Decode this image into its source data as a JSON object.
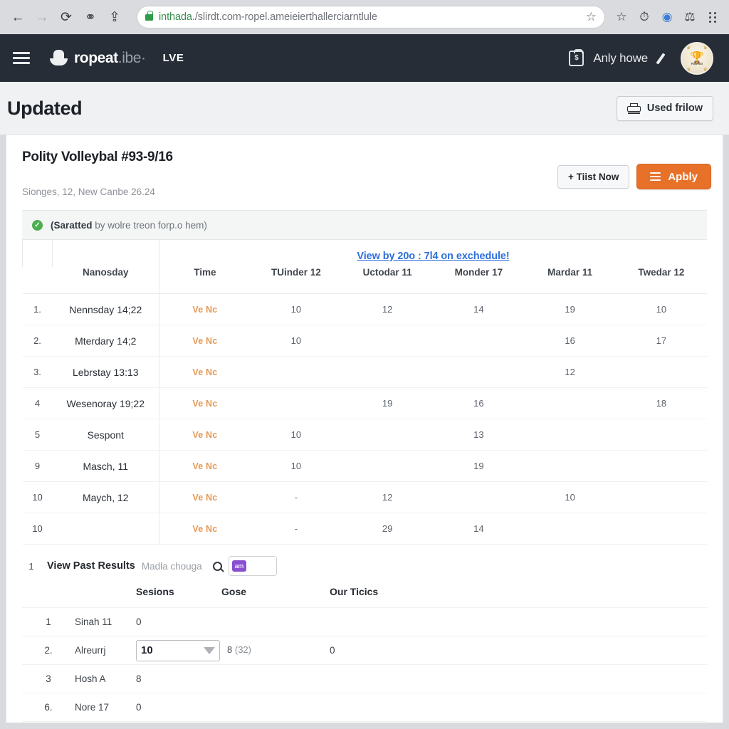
{
  "browser": {
    "back_icon": "back-arrow-icon",
    "forward_icon": "forward-arrow-icon",
    "reload_icon": "reload-icon",
    "pin_icon": "pin-icon",
    "share_icon": "share-icon",
    "url_host": "inthada.",
    "url_path": "/slirdt.com-ropel.ameieierthallerciarntlule",
    "bookmark_star": "☆",
    "toolbar_icons": [
      "star-icon",
      "history-clock-icon",
      "profile-icon",
      "extension-icon",
      "menu-dots-icon"
    ]
  },
  "appbar": {
    "menu_label": "hamburger-menu",
    "brand_primary": "ropeat",
    "brand_secondary": ".ibe·",
    "live_label": "LVE",
    "account_name": "Anly howe",
    "bag_symbol": "$",
    "avatar_crest": "🏆",
    "avatar_label": "Ropeat!",
    "avatar_bits_top": [
      "♟",
      "♟"
    ],
    "avatar_bits_bottom": [
      "♟",
      "♟"
    ]
  },
  "page_header": {
    "title": "Updated",
    "print_button": "Used frilow"
  },
  "card": {
    "title": "Polity Volleybal #93-9/16",
    "subtitle": "Sionges, 12, New Canbe 26.24",
    "btn_secondary": "+ Tiist Now",
    "btn_primary": "Apbly",
    "alert_bold": "(Saratted",
    "alert_rest": "by wolre treon forp.o hem)",
    "accent_color": "#e8712a",
    "link_color": "#2f6fdb"
  },
  "main_table": {
    "span_link": "View by 20o : 7l4 on exchedule!",
    "headers": [
      "",
      "Nanosday",
      "Time",
      "TUinder 12",
      "Uctodar 11",
      "Monder 17",
      "Mardar 11",
      "Twedar 12"
    ],
    "venue_link_label": "Ve Nc",
    "rows": [
      {
        "idx": "1.",
        "day": "Nennsday 14;22",
        "time": "Ve Nc",
        "c1": "10",
        "c2": "12",
        "c3": "14",
        "c4": "19",
        "c5": "10"
      },
      {
        "idx": "2.",
        "day": "Mterdary 14;2",
        "time": "Ve Nc",
        "c1": "10",
        "c2": "",
        "c3": "",
        "c4": "16",
        "c5": "17"
      },
      {
        "idx": "3.",
        "day": "Lebrstay 13:13",
        "time": "Ve Nc",
        "c1": "",
        "c2": "",
        "c3": "",
        "c4": "12",
        "c5": ""
      },
      {
        "idx": "4",
        "day": "Wesenoray 19;22",
        "time": "Ve Nc",
        "c1": "",
        "c2": "19",
        "c3": "16",
        "c4": "",
        "c5": "18"
      },
      {
        "idx": "5",
        "day": "Sespont",
        "time": "Ve Nc",
        "c1": "10",
        "c2": "",
        "c3": "13",
        "c4": "",
        "c5": ""
      },
      {
        "idx": "9",
        "day": "Masch, 11",
        "time": "Ve Nc",
        "c1": "10",
        "c2": "",
        "c3": "19",
        "c4": "",
        "c5": ""
      },
      {
        "idx": "10",
        "day": "Maych, 12",
        "time": "Ve Nc",
        "c1": "-",
        "c2": "12",
        "c3": "",
        "c4": "10",
        "c5": ""
      },
      {
        "idx": "10",
        "day": "",
        "time": "Ve Nc",
        "c1": "-",
        "c2": "29",
        "c3": "14",
        "c4": "",
        "c5": ""
      }
    ]
  },
  "past_results": {
    "row_index": "1",
    "title": "View Past Results",
    "note": "Madla chouga",
    "search_placeholder": "",
    "search_chip": "am",
    "headers": [
      "",
      "",
      "Sesions",
      "Gose",
      "Our Ticics"
    ],
    "rows": [
      {
        "idx": "1",
        "name": "Sinah 11",
        "sessions": "0",
        "gose": "",
        "tics": ""
      },
      {
        "idx": "2.",
        "name": "Alreurrj",
        "sessions": "",
        "gose": "",
        "tics": "0",
        "select_value": "10",
        "paren_main": "8",
        "paren_sub": "(32)"
      },
      {
        "idx": "3",
        "name": "Hosh A",
        "sessions": "8",
        "gose": "",
        "tics": ""
      },
      {
        "idx": "6.",
        "name": "Nore 17",
        "sessions": "0",
        "gose": "",
        "tics": ""
      }
    ]
  }
}
